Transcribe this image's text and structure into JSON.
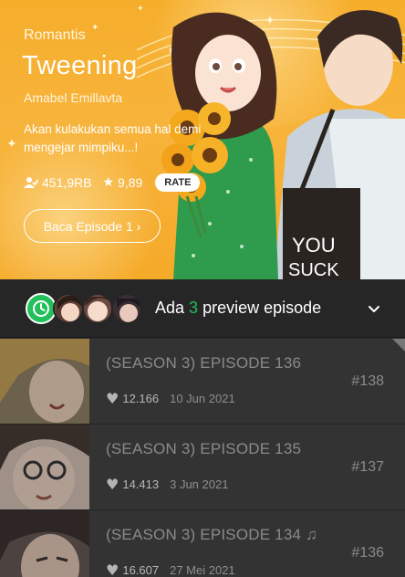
{
  "hero": {
    "genre": "Romantis",
    "title": "Tweening",
    "author": "Amabel Emillavta",
    "tagline": "Akan kulakukan semua hal demi mengejar mimpiku...!",
    "subscribers": "451,9RB",
    "rating": "9,89",
    "rate_label": "RATE",
    "read_button": "Baca Episode 1 ›",
    "bag_text_1": "YOU",
    "bag_text_2": "SUCK",
    "accent": "#f6ad2a"
  },
  "preview": {
    "prefix": "Ada",
    "count": "3",
    "suffix": "preview episode",
    "accent": "#21c05a"
  },
  "episodes": [
    {
      "title": "(SEASON 3) EPISODE 136",
      "likes": "12.166",
      "date": "10 Jun 2021",
      "number": "#138"
    },
    {
      "title": "(SEASON 3) EPISODE 135",
      "likes": "14.413",
      "date": "3 Jun 2021",
      "number": "#137"
    },
    {
      "title": "(SEASON 3) EPISODE 134 ♫",
      "likes": "16.607",
      "date": "27 Mei 2021",
      "number": "#136"
    }
  ]
}
